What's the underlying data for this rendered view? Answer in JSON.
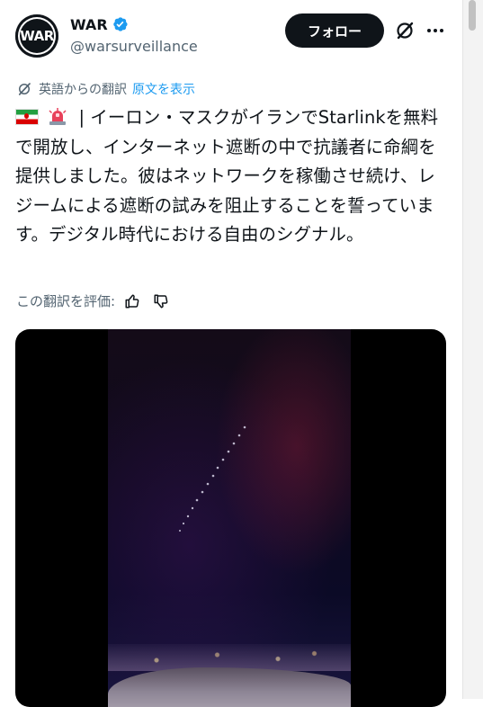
{
  "author": {
    "avatar_text": "WAR",
    "name": "WAR",
    "handle": "@warsurveillance"
  },
  "actions": {
    "follow_label": "フォロー"
  },
  "translation": {
    "note": "英語からの翻訳",
    "show_original": "原文を表示"
  },
  "tweet": {
    "text": " | イーロン・マスクがイランでStarlinkを無料で開放し、インターネット遮断の中で抗議者に命綱を提供しました。彼はネットワークを稼働させ続け、レジームによる遮断の試みを阻止することを誓っています。デジタル時代における自由のシグナル。",
    "emoji": [
      "flag-iran",
      "police-light-siren"
    ]
  },
  "rating": {
    "label": "この翻訳を評価:",
    "icons": [
      "thumbs-up-icon",
      "thumbs-down-icon"
    ]
  },
  "colors": {
    "text": "#0f1419",
    "secondary": "#536471",
    "link": "#1d9bf0",
    "verified": "#1d9bf0",
    "button_bg": "#0f1419"
  }
}
